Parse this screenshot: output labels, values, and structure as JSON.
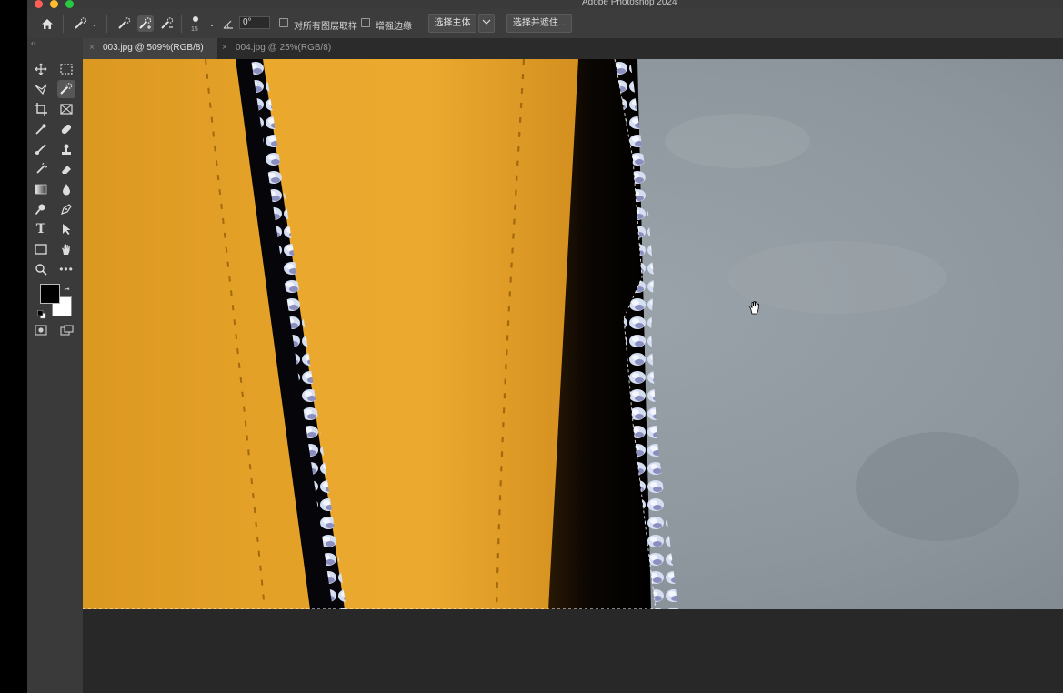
{
  "app": {
    "title": "Adobe Photoshop 2024",
    "traffic_lights": [
      "#ff5f57",
      "#febc2e",
      "#28c840"
    ]
  },
  "options_bar": {
    "home_icon": "home-icon",
    "tool_preset_icon": "quick-selection-icon",
    "mode_icons": [
      "new-selection-icon",
      "add-to-selection-icon",
      "subtract-from-selection-icon"
    ],
    "brush_size": "15",
    "angle_value": "0°",
    "sample_all_layers_label": "对所有图层取样",
    "sample_all_layers_checked": false,
    "enhance_edge_label": "增强边缘",
    "enhance_edge_checked": false,
    "select_subject_label": "选择主体",
    "select_and_mask_label": "选择并遮住..."
  },
  "tabs": [
    {
      "label": "003.jpg @ 509%(RGB/8)",
      "active": true
    },
    {
      "label": "004.jpg @ 25%(RGB/8)",
      "active": false
    }
  ],
  "toolbar": {
    "collapse_glyph": "‹‹",
    "foreground_color": "#000000",
    "background_color": "#ffffff"
  },
  "canvas": {
    "colors": {
      "leather": "#e7a52b",
      "cord": "#c9d4ec",
      "background_cloth": "#8f999f",
      "gap": "#000000"
    },
    "cursor_icon": "hand-cursor-icon"
  }
}
